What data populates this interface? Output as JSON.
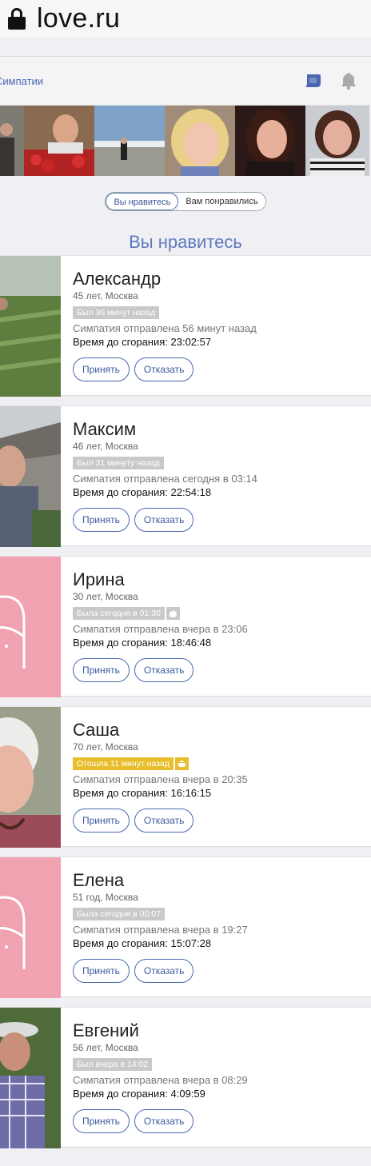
{
  "browser": {
    "url": "love.ru"
  },
  "header": {
    "link": "Симпатии",
    "chat_icon": "chat-icon",
    "bell_icon": "bell-icon"
  },
  "toggle": {
    "active": "Вы нравитесь",
    "inactive": "Вам понравились"
  },
  "section_title": "Вы нравитесь",
  "sent_prefix": "Симпатия отправлена",
  "timer_label": "Время до сгорания:",
  "accept_label": "Принять",
  "decline_label": "Отказать",
  "cards": [
    {
      "name": "Александр",
      "age_city": "45 лет, Москва",
      "status": "Был 36 минут назад",
      "status_kind": "offline",
      "sent": "Симпатия отправлена 56 минут назад",
      "timer": "Время до сгорания: 23:02:57"
    },
    {
      "name": "Максим",
      "age_city": "46 лет, Москва",
      "status": "Был 31 минуту назад",
      "status_kind": "offline",
      "sent": "Симпатия отправлена сегодня в 03:14",
      "timer": "Время до сгорания: 22:54:18"
    },
    {
      "name": "Ирина",
      "age_city": "30 лет, Москва",
      "status": "Была сегодня в 01:30",
      "status_kind": "offline",
      "os_icon": "apple-icon",
      "sent": "Симпатия отправлена вчера в 23:06",
      "timer": "Время до сгорания: 18:46:48"
    },
    {
      "name": "Саша",
      "age_city": "70 лет, Москва",
      "status": "Отошла 11 минут назад",
      "status_kind": "away",
      "os_icon": "android-icon",
      "sent": "Симпатия отправлена вчера в 20:35",
      "timer": "Время до сгорания: 16:16:15"
    },
    {
      "name": "Елена",
      "age_city": "51 год, Москва",
      "status": "Была сегодня в 00:07",
      "status_kind": "offline",
      "sent": "Симпатия отправлена вчера в 19:27",
      "timer": "Время до сгорания: 15:07:28"
    },
    {
      "name": "Евгений",
      "age_city": "56 лет, Москва",
      "status": "Был вчера в 14:02",
      "status_kind": "offline",
      "sent": "Симпатия отправлена вчера в 08:29",
      "timer": "Время до сгорания: 4:09:59"
    }
  ],
  "colors": {
    "accent": "#4a68b0",
    "away": "#e8be2c",
    "placeholder_pink": "#f0a2b1"
  }
}
